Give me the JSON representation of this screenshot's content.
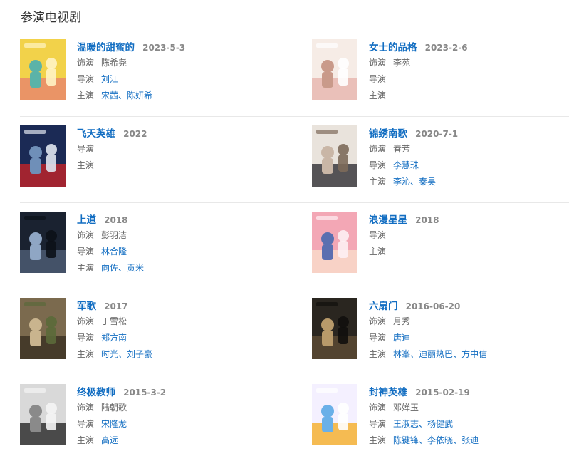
{
  "section": {
    "title": "参演电视剧"
  },
  "labels": {
    "role": "饰演",
    "director": "导演",
    "cast": "主演"
  },
  "colors": {
    "link": "#136ec2",
    "text": "#666666",
    "year": "#888888",
    "divider": "#e8e8e8"
  },
  "shows": [
    {
      "title": "温暖的甜蜜的",
      "year": "2023-5-3",
      "role": "陈希尧",
      "director": "刘江",
      "cast": [
        "宋茜",
        "陈妍希"
      ]
    },
    {
      "title": "女士的品格",
      "year": "2023-2-6",
      "role": "李苑",
      "director": "",
      "cast": []
    },
    {
      "title": "飞天英雄",
      "year": "2022",
      "role": "",
      "director": "",
      "cast": []
    },
    {
      "title": "锦绣南歌",
      "year": "2020-7-1",
      "role": "春芳",
      "director": "李慧珠",
      "cast": [
        "李沁",
        "秦昊"
      ]
    },
    {
      "title": "上道",
      "year": "2018",
      "role": "彭羽洁",
      "director": "林合隆",
      "cast": [
        "向佐",
        "贡米"
      ]
    },
    {
      "title": "浪漫星星",
      "year": "2018",
      "role": "",
      "director": "",
      "cast": []
    },
    {
      "title": "军歌",
      "year": "2017",
      "role": "丁雪松",
      "director": "郑方南",
      "cast": [
        "时光",
        "刘子豪"
      ]
    },
    {
      "title": "六扇门",
      "year": "2016-06-20",
      "role": "月秀",
      "director": "唐迪",
      "cast": [
        "林峯",
        "迪丽热巴",
        "方中信"
      ]
    },
    {
      "title": "终极教师",
      "year": "2015-3-2",
      "role": "陆朝歌",
      "director": "宋隆龙",
      "cast": [
        "高远"
      ]
    },
    {
      "title": "封神英雄",
      "year": "2015-02-19",
      "role": "邓婵玉",
      "director": "王淑志、杨健武",
      "cast": [
        "陈键锋",
        "李依晓",
        "张迪"
      ]
    }
  ]
}
